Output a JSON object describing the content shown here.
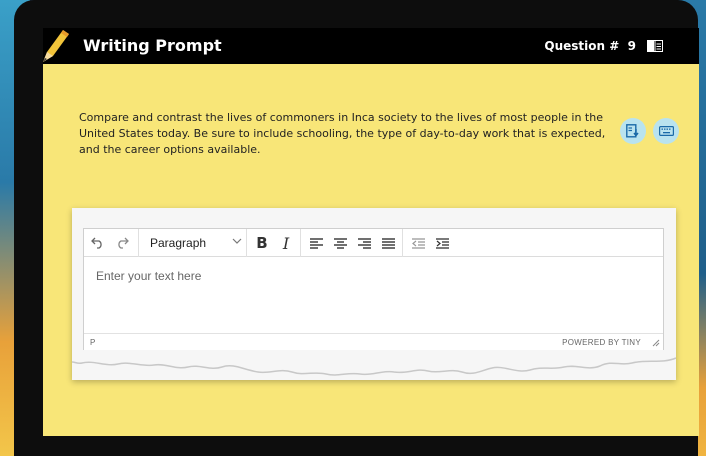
{
  "header": {
    "title": "Writing Prompt",
    "question_label": "Question #",
    "question_number": "9"
  },
  "prompt": {
    "text": "Compare and contrast the lives of commoners in Inca society to the lives of most people in the United States today. Be sure to include schooling, the type of day-to-day work that is expected, and the career options available."
  },
  "tools": {
    "tts_icon": "text-to-speech-icon",
    "keyboard_icon": "keyboard-icon"
  },
  "editor": {
    "block_format": "Paragraph",
    "bold_label": "B",
    "italic_label": "I",
    "placeholder": "Enter your text here",
    "status_path": "P",
    "branding": "POWERED BY TINY"
  },
  "colors": {
    "screen_bg": "#f8e678",
    "titlebar_bg": "#000000",
    "circle_btn_bg": "#b9e3ef",
    "pencil": "#f2c43a"
  }
}
